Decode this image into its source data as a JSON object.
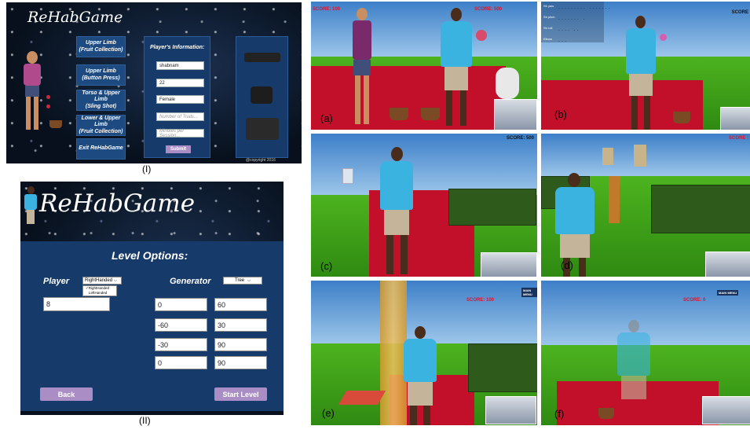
{
  "panel1": {
    "title": "ReHabGame",
    "menu": [
      {
        "label": "Upper Limb\n(Fruit Collection)"
      },
      {
        "label": "Upper Limb\n(Button Press)"
      },
      {
        "label": "Torso & Upper Limb\n(Sling Shot)"
      },
      {
        "label": "Lower & Upper Limb\n(Fruit Collection)"
      },
      {
        "label": "Exit ReHabGame"
      }
    ],
    "player_info_title": "Player's Information:",
    "fields": [
      {
        "value": "shabnam",
        "placeholder": ""
      },
      {
        "value": "22",
        "placeholder": ""
      },
      {
        "value": "Female",
        "placeholder": ""
      },
      {
        "value": "",
        "placeholder": "Number of Trials..."
      },
      {
        "value": "",
        "placeholder": "Minutes per Session..."
      }
    ],
    "submit": "Submit",
    "copyright": "@copyright 2016",
    "caption": "(I)"
  },
  "panel2": {
    "title": "ReHabGame",
    "heading": "Level Options:",
    "player_label": "Player",
    "player_select": "RightHanded",
    "player_options": [
      "RightHanded",
      "LeftHanded"
    ],
    "generator_label": "Generator",
    "generator_select": "Tree",
    "player_value": "8",
    "grid": [
      [
        "0",
        "60"
      ],
      [
        "-60",
        "30"
      ],
      [
        "-30",
        "90"
      ],
      [
        "0",
        "90"
      ]
    ],
    "back": "Back",
    "start": "Start Level",
    "caption": "(II)"
  },
  "scenes": {
    "a": {
      "label": "(a)",
      "score_left": "SCORE: 100",
      "score_right": "SCORE: 500"
    },
    "b": {
      "label": "(b)",
      "score_right": "SCORE",
      "overlay": [
        "Sh yaw",
        "Sh pitch",
        "Sh roll",
        "Elbow"
      ]
    },
    "c": {
      "label": "(c)",
      "score_right": "SCORE: 500"
    },
    "d": {
      "label": "(d)",
      "score_right": "SCORE :"
    },
    "e": {
      "label": "(e)",
      "score": "SCORE: 100",
      "menu": "MAIN MENU"
    },
    "f": {
      "label": "(f)",
      "score": "SCORE: 0",
      "menu": "MAIN MENU"
    }
  },
  "colors": {
    "accent_blue": "#1d4a80",
    "panel_blue": "#163a69",
    "score_red": "#e3102a",
    "button_purple": "#a98dc4"
  }
}
